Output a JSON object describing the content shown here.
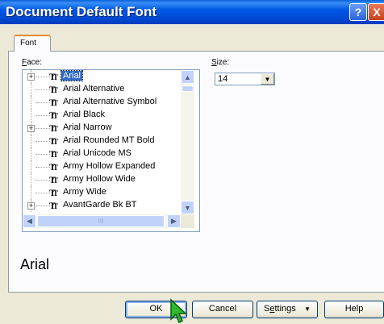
{
  "window": {
    "title": "Document Default Font",
    "help_symbol": "?",
    "close_symbol": "X"
  },
  "tabs": [
    {
      "label": "Font"
    }
  ],
  "face": {
    "label_prefix": "",
    "label_accel": "F",
    "label_rest": "ace:",
    "selected": "Arial",
    "items": [
      {
        "name": "Arial",
        "expandable": true,
        "selected": true
      },
      {
        "name": "Arial Alternative",
        "expandable": false
      },
      {
        "name": "Arial Alternative Symbol",
        "expandable": false
      },
      {
        "name": "Arial Black",
        "expandable": false
      },
      {
        "name": "Arial Narrow",
        "expandable": true
      },
      {
        "name": "Arial Rounded MT Bold",
        "expandable": false
      },
      {
        "name": "Arial Unicode MS",
        "expandable": false
      },
      {
        "name": "Army Hollow Expanded",
        "expandable": false
      },
      {
        "name": "Army Hollow Wide",
        "expandable": false
      },
      {
        "name": "Army Wide",
        "expandable": false
      },
      {
        "name": "AvantGarde Bk BT",
        "expandable": true
      }
    ],
    "expander_symbol": "+",
    "tt_glyph": "T",
    "scroll_up_icon": "▲",
    "scroll_down_icon": "▼",
    "scroll_left_icon": "◀",
    "scroll_right_icon": "▶",
    "hthumb_grip": "III"
  },
  "size": {
    "label_accel": "S",
    "label_rest": "ize:",
    "value": "14",
    "dropdown_icon": "▼"
  },
  "preview": {
    "text": "Arial"
  },
  "buttons": {
    "ok": "OK",
    "cancel": "Cancel",
    "settings_accel": "e",
    "settings_pre": "S",
    "settings_post": "ttings",
    "settings_arrow": "▼",
    "help": "Help"
  },
  "colors": {
    "selection": "#316ac5",
    "titlebar": "#0058e6",
    "dialog_bg": "#ece9d8"
  }
}
